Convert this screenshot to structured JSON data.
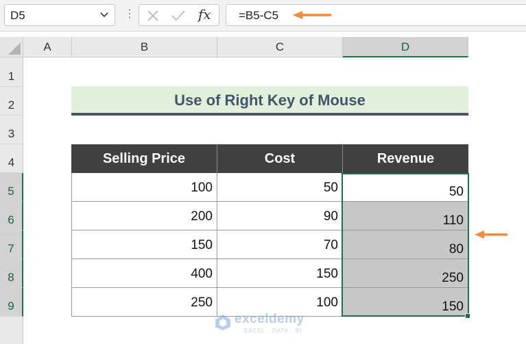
{
  "formula_bar": {
    "name_box": "D5",
    "formula": "=B5-C5",
    "fx_label": "fx",
    "cancel_icon": "x-icon",
    "enter_icon": "check-icon"
  },
  "columns": [
    "A",
    "B",
    "C",
    "D"
  ],
  "rows": [
    "1",
    "2",
    "3",
    "4",
    "5",
    "6",
    "7",
    "8",
    "9"
  ],
  "title": "Use of Right Key of Mouse",
  "table": {
    "headers": [
      "Selling Price",
      "Cost",
      "Revenue"
    ],
    "rows": [
      {
        "price": "100",
        "cost": "50",
        "revenue": "50"
      },
      {
        "price": "200",
        "cost": "90",
        "revenue": "110"
      },
      {
        "price": "150",
        "cost": "70",
        "revenue": "80"
      },
      {
        "price": "400",
        "cost": "150",
        "revenue": "250"
      },
      {
        "price": "250",
        "cost": "100",
        "revenue": "150"
      }
    ]
  },
  "colors": {
    "accent": "#1f7145",
    "arrow": "#f28a3c",
    "title_bg": "#e2efda",
    "header_bg": "#404040"
  },
  "watermark": {
    "brand": "exceldemy",
    "tagline": "EXCEL · DATA · BI"
  }
}
